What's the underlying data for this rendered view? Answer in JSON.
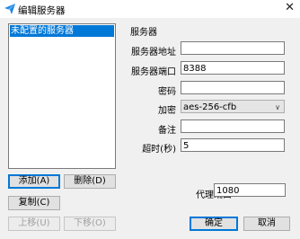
{
  "window": {
    "title": "编辑服务器",
    "app_icon": "paper-plane-icon",
    "close_glyph": "✕"
  },
  "server_list": {
    "items": [
      "未配置的服务器"
    ]
  },
  "buttons": {
    "add": "添加(A)",
    "delete": "删除(D)",
    "copy": "复制(C)",
    "move_up": "上移(U)",
    "move_down": "下移(O)",
    "ok": "确定",
    "cancel": "取消"
  },
  "server_group": {
    "title": "服务器",
    "fields": {
      "address": {
        "label": "服务器地址",
        "value": ""
      },
      "port": {
        "label": "服务器端口",
        "value": "8388"
      },
      "password": {
        "label": "密码",
        "value": ""
      },
      "encryption": {
        "label": "加密",
        "value": "aes-256-cfb"
      },
      "remarks": {
        "label": "备注",
        "value": ""
      },
      "timeout": {
        "label": "超时(秒)",
        "value": "5"
      }
    }
  },
  "proxy_port": {
    "label": "代理端口",
    "value": "1080"
  },
  "colors": {
    "selection": "#0078d7",
    "app_icon": "#1e88e5"
  }
}
